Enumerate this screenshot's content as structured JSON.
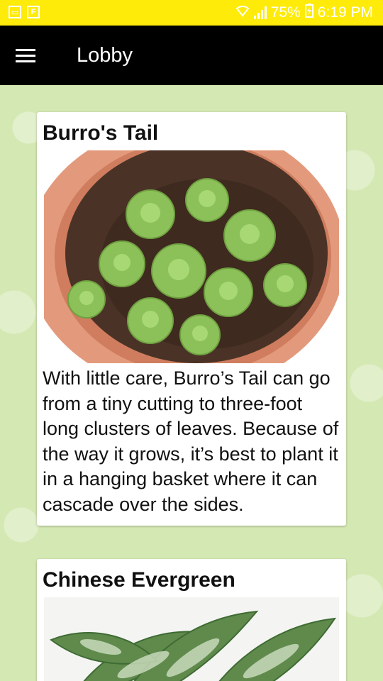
{
  "status_bar": {
    "battery": "75%",
    "time": "6:19 PM",
    "icons": [
      "gallery-icon",
      "flipboard-icon",
      "wifi-icon",
      "signal-icon",
      "battery-charging-icon"
    ],
    "background_color": "#ffeb0a"
  },
  "app_bar": {
    "title": "Lobby",
    "menu_icon": "hamburger-menu-icon",
    "background_color": "#000000"
  },
  "cards": [
    {
      "title": "Burro's Tail",
      "image": "burros-tail-plant-image",
      "description": "With little care, Burro’s Tail can go from a tiny cutting to three-foot long clusters of leaves. Because of the way it grows, it’s best to plant it in a hanging basket where it can cascade over the sides."
    },
    {
      "title": "Chinese Evergreen",
      "image": "chinese-evergreen-plant-image"
    }
  ],
  "colors": {
    "background": "#d4e8b3",
    "card": "#ffffff"
  }
}
